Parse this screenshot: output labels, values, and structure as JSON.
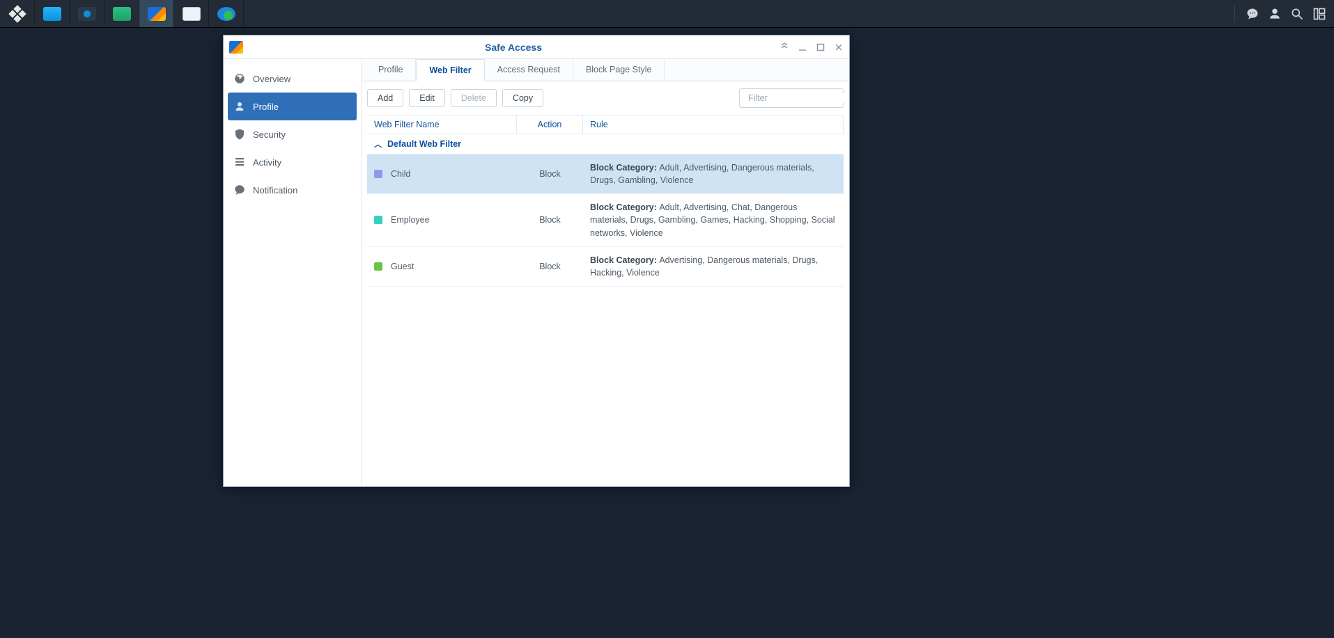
{
  "taskbar": {
    "right_icons": [
      "chat-icon",
      "user-icon",
      "search-icon",
      "widgets-icon"
    ]
  },
  "window": {
    "title": "Safe Access",
    "sidebar": {
      "items": [
        {
          "id": "overview",
          "label": "Overview"
        },
        {
          "id": "profile",
          "label": "Profile",
          "selected": true
        },
        {
          "id": "security",
          "label": "Security"
        },
        {
          "id": "activity",
          "label": "Activity"
        },
        {
          "id": "notification",
          "label": "Notification"
        }
      ]
    },
    "tabs": [
      {
        "id": "profile",
        "label": "Profile"
      },
      {
        "id": "webfilter",
        "label": "Web Filter",
        "active": true
      },
      {
        "id": "accessrequest",
        "label": "Access Request"
      },
      {
        "id": "blockpagestyle",
        "label": "Block Page Style"
      }
    ],
    "toolbar": {
      "add": "Add",
      "edit": "Edit",
      "delete": "Delete",
      "copy": "Copy",
      "filter_placeholder": "Filter"
    },
    "grid": {
      "headers": {
        "name": "Web Filter Name",
        "action": "Action",
        "rule": "Rule"
      },
      "group_label": "Default Web Filter",
      "rule_label_text": "Block Category: ",
      "rows": [
        {
          "name": "Child",
          "swatch": "#8f98e8",
          "action": "Block",
          "rule": "Adult, Advertising, Dangerous materials, Drugs, Gambling, Violence",
          "selected": true
        },
        {
          "name": "Employee",
          "swatch": "#36d0c0",
          "action": "Block",
          "rule": "Adult, Advertising, Chat, Dangerous materials, Drugs, Gambling, Games, Hacking, Shopping, Social networks, Violence"
        },
        {
          "name": "Guest",
          "swatch": "#6bc24a",
          "action": "Block",
          "rule": "Advertising, Dangerous materials, Drugs, Hacking, Violence"
        }
      ]
    }
  }
}
